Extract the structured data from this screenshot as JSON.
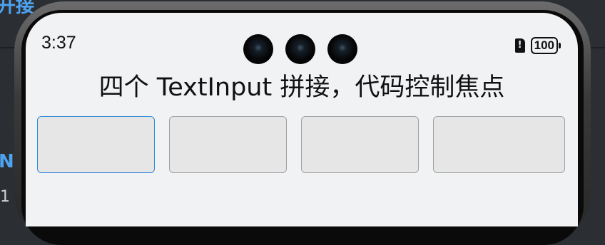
{
  "background": {
    "top_text": "开接",
    "side_text": "N",
    "side_text_2": "1"
  },
  "status_bar": {
    "time": "3:37",
    "sim_icon": "sim-alert-icon",
    "sim_glyph": "!",
    "battery_level": "100",
    "battery_icon": "battery-icon"
  },
  "cameras": [
    "camera-lens-icon",
    "camera-lens-icon",
    "camera-lens-icon"
  ],
  "page": {
    "title": "四个 TextInput 拼接，代码控制焦点"
  },
  "inputs": [
    {
      "value": "",
      "placeholder": "",
      "focused": true
    },
    {
      "value": "",
      "placeholder": "",
      "focused": false
    },
    {
      "value": "",
      "placeholder": "",
      "focused": false
    },
    {
      "value": "",
      "placeholder": "",
      "focused": false
    }
  ],
  "colors": {
    "focus_border": "#2f86d3",
    "input_border": "#a0a0a0",
    "input_bg": "#e6e6e6",
    "screen_bg": "#f1f2f4",
    "accent_text": "#4ea3f0"
  }
}
